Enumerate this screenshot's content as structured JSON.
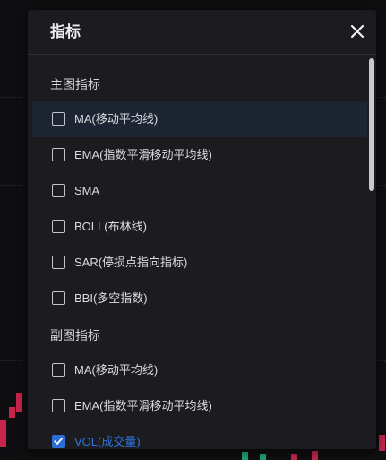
{
  "dialog": {
    "title": "指标",
    "close_icon": "close-icon"
  },
  "sections": [
    {
      "title": "主图指标",
      "items": [
        {
          "label": "MA(移动平均线)",
          "checked": false,
          "highlighted": true
        },
        {
          "label": "EMA(指数平滑移动平均线)",
          "checked": false,
          "highlighted": false
        },
        {
          "label": "SMA",
          "checked": false,
          "highlighted": false
        },
        {
          "label": "BOLL(布林线)",
          "checked": false,
          "highlighted": false
        },
        {
          "label": "SAR(停损点指向指标)",
          "checked": false,
          "highlighted": false
        },
        {
          "label": "BBI(多空指数)",
          "checked": false,
          "highlighted": false
        }
      ]
    },
    {
      "title": "副图指标",
      "items": [
        {
          "label": "MA(移动平均线)",
          "checked": false,
          "highlighted": false
        },
        {
          "label": "EMA(指数平滑移动平均线)",
          "checked": false,
          "highlighted": false
        },
        {
          "label": "VOL(成交量)",
          "checked": true,
          "highlighted": false
        }
      ]
    }
  ],
  "colors": {
    "accent": "#2b6fd6",
    "panel_bg": "#1c1c20",
    "highlight_bg": "#1e2532",
    "text": "#dcdce0"
  }
}
